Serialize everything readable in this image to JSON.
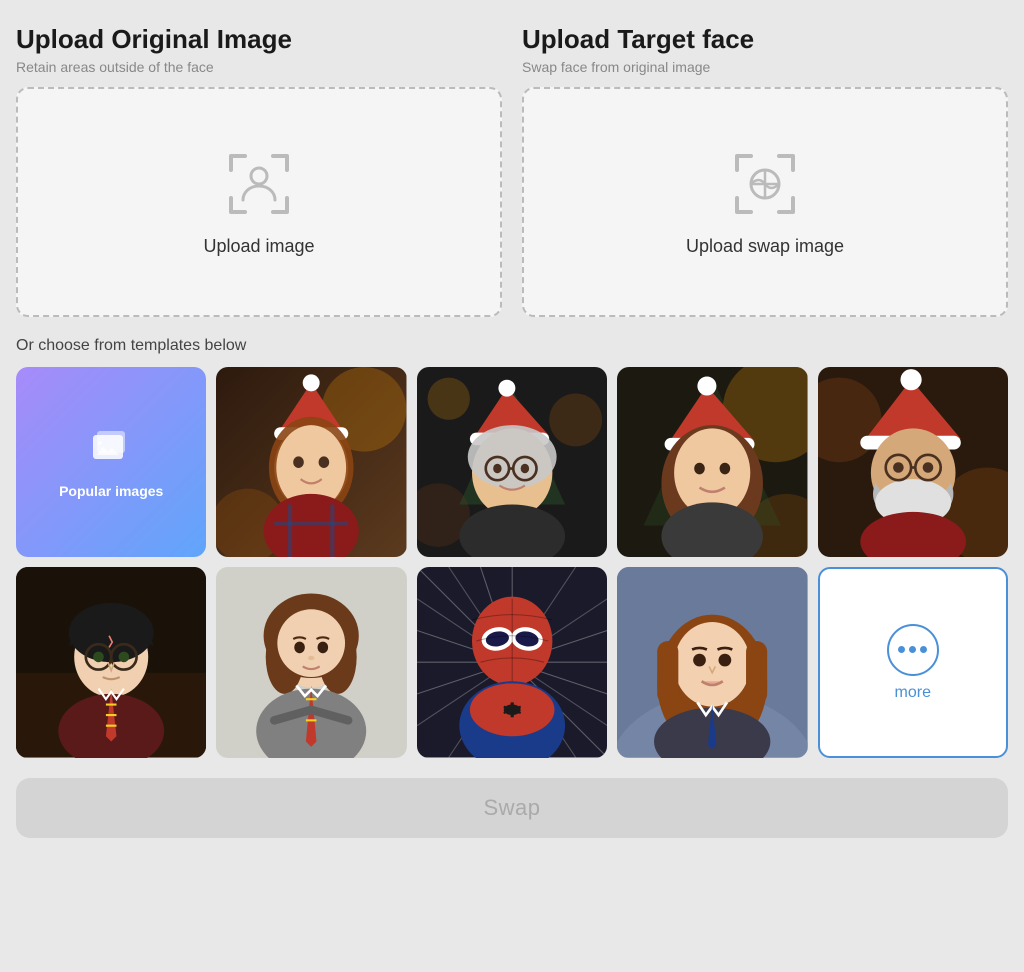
{
  "upload_original": {
    "title": "Upload Original Image",
    "subtitle": "Retain areas outside of the face",
    "drop_label": "Upload image",
    "zone_id": "upload-original-zone"
  },
  "upload_target": {
    "title": "Upload Target face",
    "subtitle": "Swap face from original image",
    "drop_label": "Upload swap image",
    "zone_id": "upload-target-zone"
  },
  "templates": {
    "section_label": "Or choose from templates below",
    "popular_label": "Popular images",
    "more_label": "more",
    "items": [
      {
        "id": "popular",
        "type": "popular"
      },
      {
        "id": "girl-santa",
        "type": "image",
        "alt": "Girl with Santa hat"
      },
      {
        "id": "woman-santa",
        "type": "image",
        "alt": "Woman with Santa hat and glasses"
      },
      {
        "id": "teen-santa",
        "type": "image",
        "alt": "Teen with Santa hat"
      },
      {
        "id": "man-santa",
        "type": "image",
        "alt": "Bearded man with Santa hat"
      },
      {
        "id": "harry-potter",
        "type": "image",
        "alt": "Harry Potter character"
      },
      {
        "id": "hermione",
        "type": "image",
        "alt": "Hermione character"
      },
      {
        "id": "spiderman",
        "type": "image",
        "alt": "Spiderman character"
      },
      {
        "id": "girl-portrait",
        "type": "image",
        "alt": "Girl portrait"
      },
      {
        "id": "more",
        "type": "more"
      }
    ]
  },
  "swap_button": {
    "label": "Swap"
  },
  "colors": {
    "accent": "#4a90d9",
    "popular_gradient_start": "#a78bfa",
    "popular_gradient_end": "#60a5fa"
  }
}
